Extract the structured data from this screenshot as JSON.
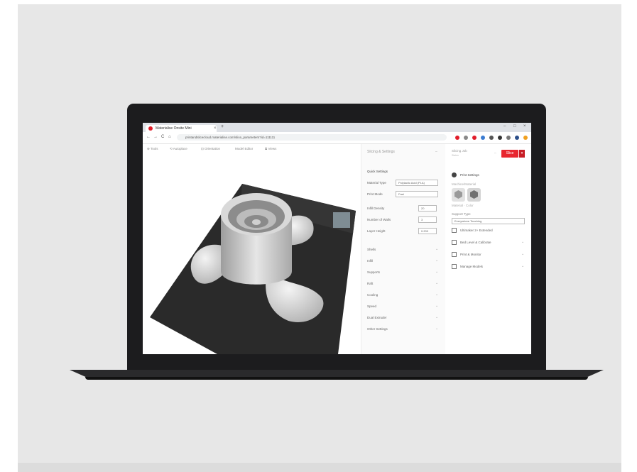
{
  "browser": {
    "tab_title": "Materialise Onsite Mini",
    "tab_close": "×",
    "new_tab": "+",
    "window_controls": [
      "–",
      "□",
      "×"
    ],
    "nav": [
      "←",
      "→",
      "C",
      "⌂"
    ],
    "url": "printandslicecloud.materialise.com/slice_parameters?id=111111"
  },
  "toolbar": [
    "⊕ Tools",
    "⟲ Autoplace",
    "⊡ Orientation",
    "Model Editor",
    "⧉ Views"
  ],
  "panel": {
    "title": "Slicing & Settings",
    "section_header": "Quick Settings",
    "rows": [
      {
        "label": "Material Type",
        "value": "Polylactic Acid (PLA)"
      },
      {
        "label": "Print Mode",
        "value": "Fast"
      }
    ],
    "number_rows": [
      {
        "label": "Infill Density",
        "value": "20"
      },
      {
        "label": "Number of Walls",
        "value": "3"
      },
      {
        "label": "Layer Height",
        "value": "0.200"
      }
    ],
    "sections": [
      "Shells",
      "Infill",
      "Supports",
      "Raft",
      "Cooling",
      "Speed",
      "Dual Extruder",
      "Other Settings"
    ]
  },
  "side": {
    "title": "Slicing Job",
    "subtitle": "Status",
    "slice_label": "Slice",
    "dropdown": "▾",
    "machine_label": "Print Settings",
    "machine_sub": "Machine/Material",
    "cube_label": "Material · Color",
    "select_label": "Support Type",
    "select_value": "Everywhere Touching",
    "toggle_label": "Ultimaker 2+ Extended",
    "items": [
      "Bed Level & Calibrate",
      "Print & Monitor",
      "Manage Models"
    ]
  },
  "colors": {
    "accent": "#e8262f",
    "bed": "#2a2a2a",
    "part": "#cfcfcf"
  }
}
